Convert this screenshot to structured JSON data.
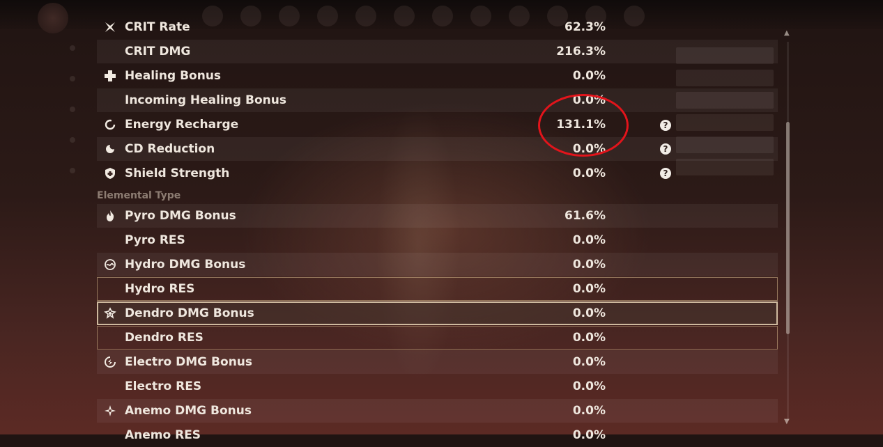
{
  "stats": [
    {
      "icon": "crit-rate-icon",
      "label": "CRIT Rate",
      "value": "62.3%"
    },
    {
      "icon": "",
      "label": "CRIT DMG",
      "value": "216.3%"
    },
    {
      "icon": "healing-icon",
      "label": "Healing Bonus",
      "value": "0.0%"
    },
    {
      "icon": "",
      "label": "Incoming Healing Bonus",
      "value": "0.0%"
    },
    {
      "icon": "energy-recharge-icon",
      "label": "Energy Recharge",
      "value": "131.1%"
    },
    {
      "icon": "cd-reduction-icon",
      "label": "CD Reduction",
      "value": "0.0%"
    },
    {
      "icon": "shield-icon",
      "label": "Shield Strength",
      "value": "0.0%"
    }
  ],
  "section_title": "Elemental Type",
  "elemental": [
    {
      "icon": "pyro-icon",
      "label": "Pyro DMG Bonus",
      "value": "61.6%"
    },
    {
      "icon": "",
      "label": "Pyro RES",
      "value": "0.0%"
    },
    {
      "icon": "hydro-icon",
      "label": "Hydro DMG Bonus",
      "value": "0.0%"
    },
    {
      "icon": "",
      "label": "Hydro RES",
      "value": "0.0%"
    },
    {
      "icon": "dendro-icon",
      "label": "Dendro DMG Bonus",
      "value": "0.0%"
    },
    {
      "icon": "",
      "label": "Dendro RES",
      "value": "0.0%"
    },
    {
      "icon": "electro-icon",
      "label": "Electro DMG Bonus",
      "value": "0.0%"
    },
    {
      "icon": "",
      "label": "Electro RES",
      "value": "0.0%"
    },
    {
      "icon": "anemo-icon",
      "label": "Anemo DMG Bonus",
      "value": "0.0%"
    },
    {
      "icon": "",
      "label": "Anemo RES",
      "value": "0.0%"
    }
  ],
  "help_glyph": "?",
  "colors": {
    "annotation": "#e2141b",
    "selected_border": "#e6d2b4"
  }
}
